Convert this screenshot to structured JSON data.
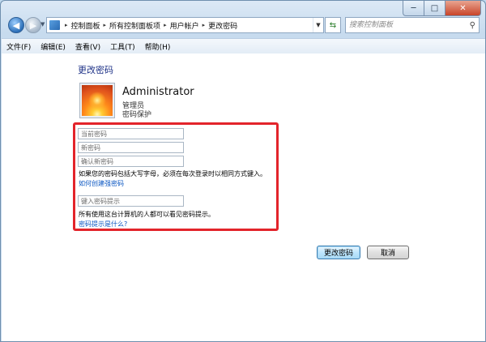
{
  "window": {
    "caption": {
      "minimize": "─",
      "maximize": "□",
      "close": "✕"
    }
  },
  "address_bar": {
    "breadcrumbs": [
      "控制面板",
      "所有控制面板项",
      "用户帐户",
      "更改密码"
    ],
    "separator": "▸"
  },
  "search": {
    "placeholder": "搜索控制面板"
  },
  "menu": [
    "文件(F)",
    "编辑(E)",
    "查看(V)",
    "工具(T)",
    "帮助(H)"
  ],
  "page": {
    "title": "更改密码",
    "user": {
      "name": "Administrator",
      "role": "管理员",
      "status": "密码保护"
    }
  },
  "form": {
    "current_password_placeholder": "当前密码",
    "new_password_placeholder": "新密码",
    "confirm_password_placeholder": "确认新密码",
    "caps_note": "如果您的密码包括大写字母，必须在每次登录时以相同方式键入。",
    "strong_password_link": "如何创建强密码",
    "hint_placeholder": "键入密码提示",
    "hint_note": "所有使用这台计算机的人都可以看见密码提示。",
    "hint_link": "密码提示是什么?"
  },
  "buttons": {
    "change_password": "更改密码",
    "cancel": "取消"
  },
  "colors": {
    "highlight_border": "#e3242b",
    "link": "#0a56c2",
    "title": "#1e3287"
  }
}
